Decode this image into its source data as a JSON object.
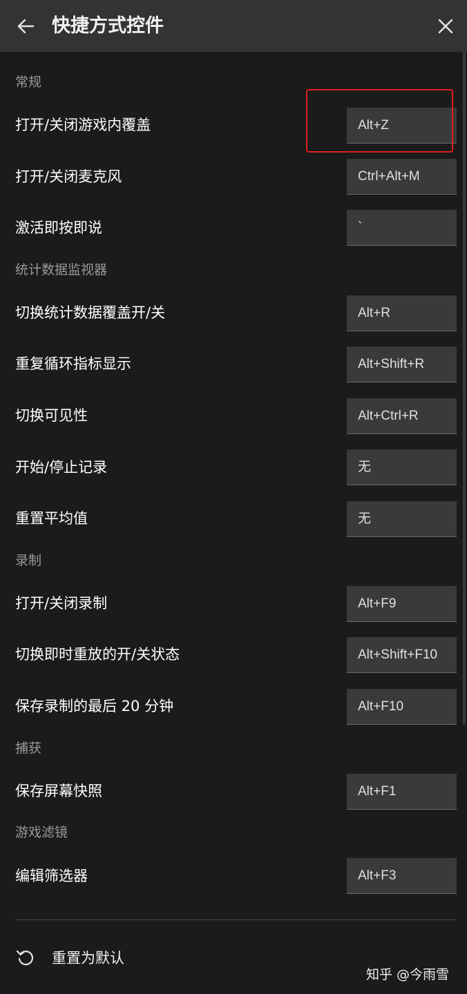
{
  "header": {
    "title": "快捷方式控件",
    "back_icon": "arrow-left-icon",
    "close_icon": "close-icon"
  },
  "sections": [
    {
      "title": "常规",
      "items": [
        {
          "label": "打开/关闭游戏内覆盖",
          "key": "Alt+Z"
        },
        {
          "label": "打开/关闭麦克风",
          "key": "Ctrl+Alt+M"
        },
        {
          "label": "激活即按即说",
          "key": "`"
        }
      ]
    },
    {
      "title": "统计数据监视器",
      "items": [
        {
          "label": "切换统计数据覆盖开/关",
          "key": "Alt+R"
        },
        {
          "label": "重复循环指标显示",
          "key": "Alt+Shift+R"
        },
        {
          "label": "切换可见性",
          "key": "Alt+Ctrl+R"
        },
        {
          "label": "开始/停止记录",
          "key": "无"
        },
        {
          "label": "重置平均值",
          "key": "无"
        }
      ]
    },
    {
      "title": "录制",
      "items": [
        {
          "label": "打开/关闭录制",
          "key": "Alt+F9"
        },
        {
          "label": "切换即时重放的开/关状态",
          "key": "Alt+Shift+F10"
        },
        {
          "label": "保存录制的最后 20 分钟",
          "key": "Alt+F10"
        }
      ]
    },
    {
      "title": "捕获",
      "items": [
        {
          "label": "保存屏幕快照",
          "key": "Alt+F1"
        }
      ]
    },
    {
      "title": "游戏滤镜",
      "items": [
        {
          "label": "编辑筛选器",
          "key": "Alt+F3"
        }
      ]
    }
  ],
  "footer": {
    "reset_label": "重置为默认",
    "reset_icon": "reset-icon"
  },
  "watermark": "知乎 @今雨雪",
  "colors": {
    "background": "#1b1b1b",
    "header": "#333333",
    "key_box": "#3a3a3a",
    "section_text": "#9a9a9a",
    "highlight": "#e02020"
  }
}
